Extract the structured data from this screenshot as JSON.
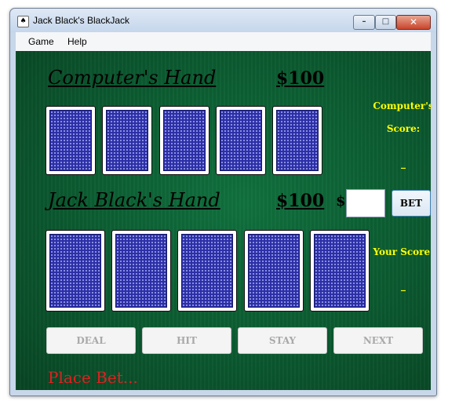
{
  "window": {
    "title": "Jack Black's BlackJack",
    "icon": "cards-app-icon"
  },
  "menu": {
    "items": [
      "Game",
      "Help"
    ]
  },
  "computer": {
    "title": "Computer's Hand",
    "money": "$100",
    "score_label_line1": "Computer's",
    "score_label_line2": "Score:",
    "score_value": "_",
    "cards": [
      "back",
      "back",
      "back",
      "back",
      "back"
    ]
  },
  "player": {
    "title": "Jack Black's Hand",
    "money": "$100",
    "score_label": "Your Score:",
    "score_value": "_",
    "cards": [
      "back",
      "back",
      "back",
      "back",
      "back"
    ]
  },
  "bet": {
    "dollar_sign": "$",
    "input_value": "",
    "button_label": "BET"
  },
  "actions": {
    "deal": "DEAL",
    "hit": "HIT",
    "stay": "STAY",
    "next": "NEXT"
  },
  "status": {
    "message": "Place Bet..."
  },
  "colors": {
    "felt": "#0b5a30",
    "score_text": "#ffff00",
    "status_text": "#e02020",
    "card_back": "#2b2ea5"
  }
}
